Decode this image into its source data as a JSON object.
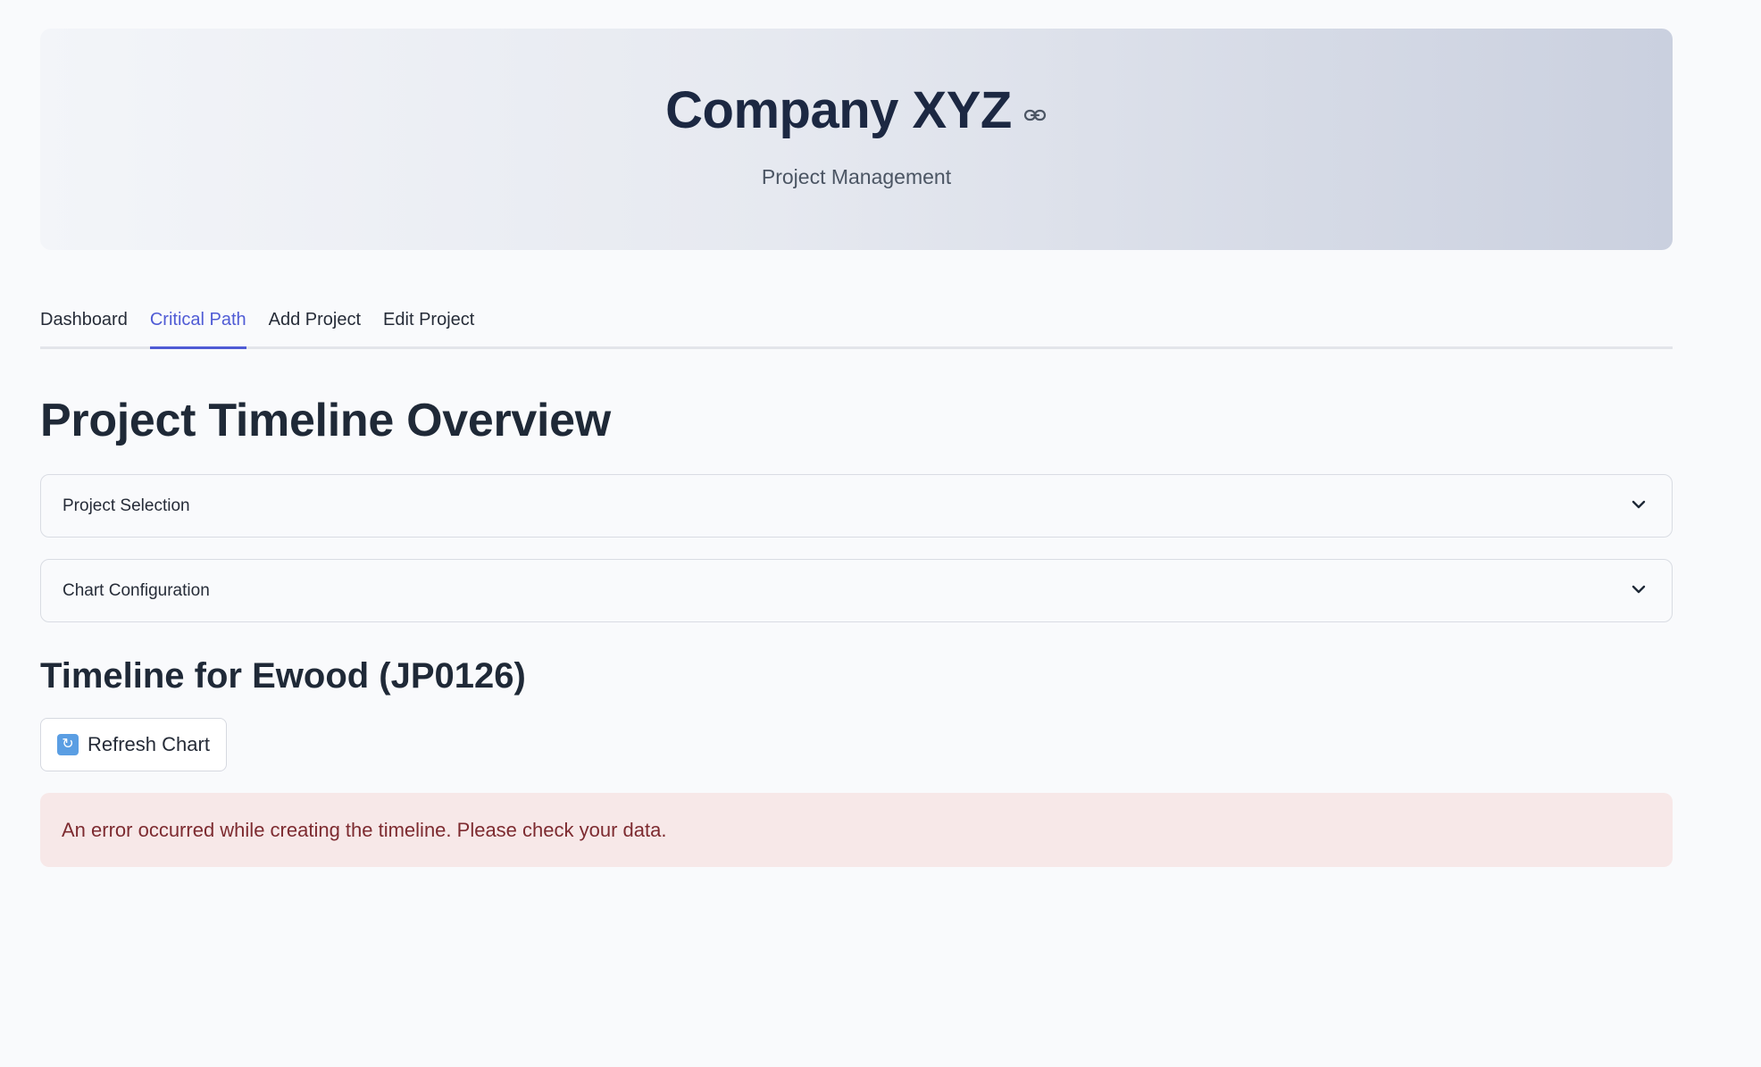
{
  "header": {
    "title": "Company XYZ",
    "subtitle": "Project Management",
    "link_icon": "link-icon"
  },
  "tabs": [
    {
      "label": "Dashboard",
      "active": false
    },
    {
      "label": "Critical Path",
      "active": true
    },
    {
      "label": "Add Project",
      "active": false
    },
    {
      "label": "Edit Project",
      "active": false
    }
  ],
  "main": {
    "title": "Project Timeline Overview",
    "expanders": [
      {
        "label": "Project Selection",
        "icon": "chevron-down-icon"
      },
      {
        "label": "Chart Configuration",
        "icon": "chevron-down-icon"
      }
    ],
    "section_title": "Timeline for Ewood (JP0126)",
    "refresh_button": {
      "label": "Refresh Chart",
      "icon": "refresh-icon"
    },
    "error_message": "An error occurred while creating the timeline. Please check your data."
  },
  "colors": {
    "accent": "#4f5bd5",
    "error_bg": "#f7e8e8",
    "error_text": "#7d2b30",
    "refresh_icon_bg": "#5a9ee3"
  }
}
